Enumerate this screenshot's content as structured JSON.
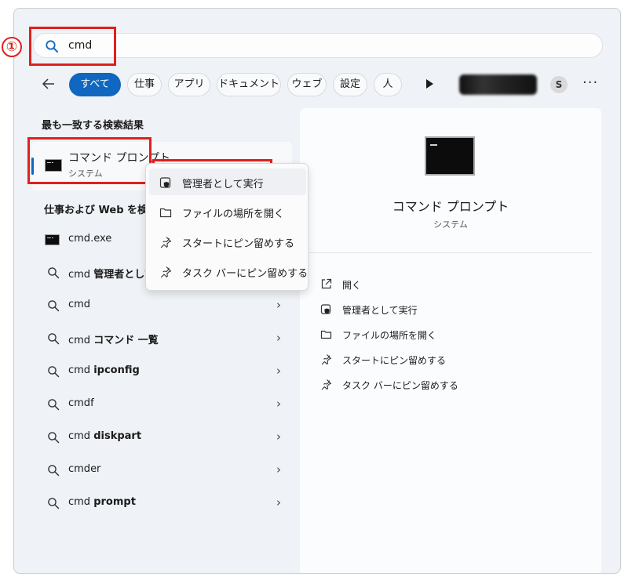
{
  "annotation": {
    "step_number": "①"
  },
  "search": {
    "query": "cmd"
  },
  "filters": {
    "chips": [
      "すべて",
      "仕事",
      "アプリ",
      "ドキュメント",
      "ウェブ",
      "設定",
      "人"
    ],
    "avatar_letter": "S",
    "more": "···"
  },
  "best_match": {
    "section_title": "最も一致する検索結果",
    "title": "コマンド プロンプト",
    "subtitle": "システム"
  },
  "web_section": {
    "title": "仕事および Web を検索"
  },
  "results": [
    {
      "prefix": "cmd.exe",
      "bold": "",
      "icon": "cmd-icon"
    },
    {
      "prefix": "cmd ",
      "bold": "管理者として",
      "icon": "search-icon"
    },
    {
      "prefix": "cmd",
      "bold": "",
      "icon": "search-icon"
    },
    {
      "prefix": "cmd ",
      "bold": "コマンド 一覧",
      "icon": "search-icon"
    },
    {
      "prefix": "cmd ",
      "bold": "ipconfig",
      "icon": "search-icon"
    },
    {
      "prefix": "cmdf",
      "bold": "",
      "icon": "search-icon"
    },
    {
      "prefix": "cmd ",
      "bold": "diskpart",
      "icon": "search-icon"
    },
    {
      "prefix": "cmder",
      "bold": "",
      "icon": "search-icon"
    },
    {
      "prefix": "cmd ",
      "bold": "prompt",
      "icon": "search-icon"
    }
  ],
  "context_menu": {
    "items": [
      "管理者として実行",
      "ファイルの場所を開く",
      "スタートにピン留めする",
      "タスク バーにピン留めする"
    ]
  },
  "preview": {
    "title": "コマンド プロンプト",
    "subtitle": "システム",
    "actions": [
      "開く",
      "管理者として実行",
      "ファイルの場所を開く",
      "スタートにピン留めする",
      "タスク バーにピン留めする"
    ]
  },
  "colors": {
    "accent": "#0f67c0",
    "highlight_box": "#e0201f"
  }
}
